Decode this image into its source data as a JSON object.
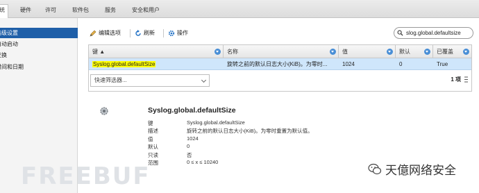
{
  "tabs": [
    {
      "label": "系统"
    },
    {
      "label": "硬件"
    },
    {
      "label": "许可"
    },
    {
      "label": "软件包"
    },
    {
      "label": "服务"
    },
    {
      "label": "安全和用户"
    }
  ],
  "sidebar": {
    "items": [
      {
        "label": "高级设置"
      },
      {
        "label": "自动启动"
      },
      {
        "label": "交换"
      },
      {
        "label": "时间和日期"
      }
    ]
  },
  "toolbar": {
    "edit_label": "编辑选项",
    "refresh_label": "刷新",
    "actions_label": "操作"
  },
  "search": {
    "value": "slog.global.defaultsize"
  },
  "grid": {
    "columns": [
      "键 ▲",
      "名称",
      "值",
      "默认",
      "已覆盖"
    ],
    "row": {
      "key": "Syslog.global.defaultSize",
      "name": "旋转之前的默认日志大小(KiB)。为零时...",
      "value": "1024",
      "default": "0",
      "overridden": "True"
    },
    "filter_placeholder": "快速筛选器...",
    "count": "1 项"
  },
  "detail": {
    "title": "Syslog.global.defaultSize",
    "rows": [
      {
        "label": "键",
        "value": "Syslog.global.defaultSize"
      },
      {
        "label": "描述",
        "value": "旋转之前的默认日志大小(KiB)。为零时重置为默认值。"
      },
      {
        "label": "值",
        "value": "1024"
      },
      {
        "label": "默认",
        "value": "0"
      },
      {
        "label": "只读",
        "value": "否"
      },
      {
        "label": "范围",
        "value": "0 ≤ x ≤ 10240"
      }
    ]
  },
  "watermarks": {
    "left": "FREEBUF",
    "right": "天億网络安全"
  },
  "colors": {
    "accent": "#1f5fa8",
    "selected_row": "#cfe6fb",
    "highlight": "#ffff00"
  }
}
